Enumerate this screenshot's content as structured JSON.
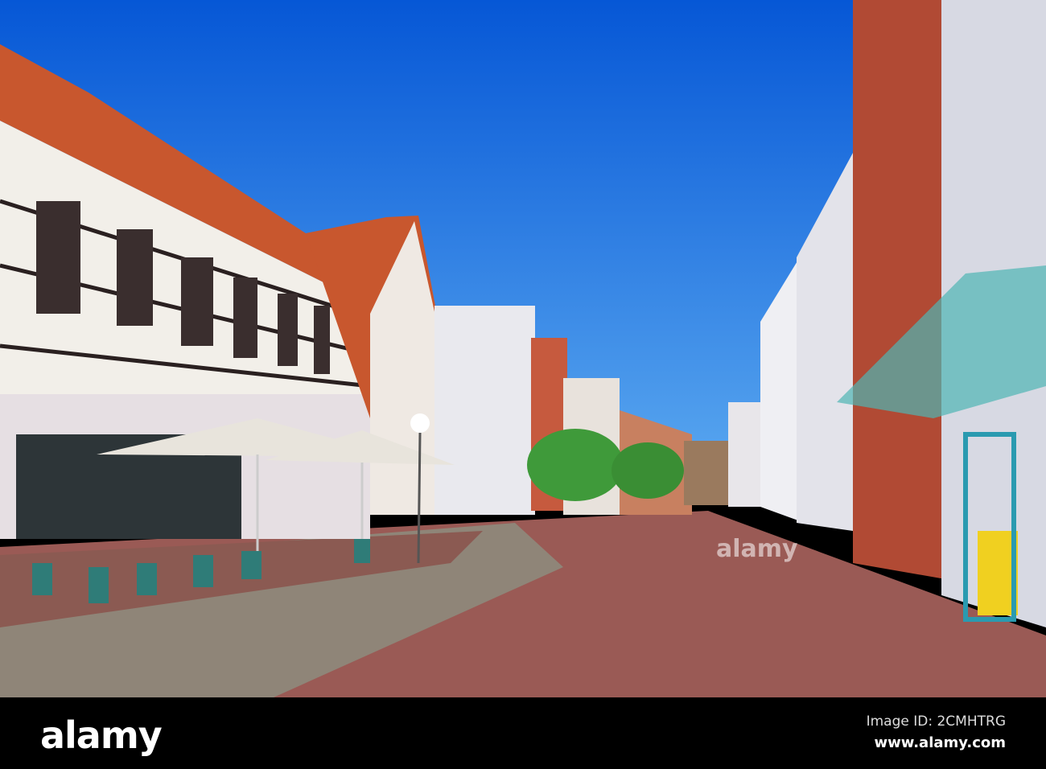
{
  "watermark": {
    "logo": "alamy",
    "overlay_text": "alamy"
  },
  "footer": {
    "image_id": "Image ID: 2CMHTRG",
    "url": "www.alamy.com"
  },
  "colors": {
    "sky": "#0a6be0",
    "roof": "#c8572e",
    "pavement": "#9a5a55",
    "footer": "#000000"
  }
}
